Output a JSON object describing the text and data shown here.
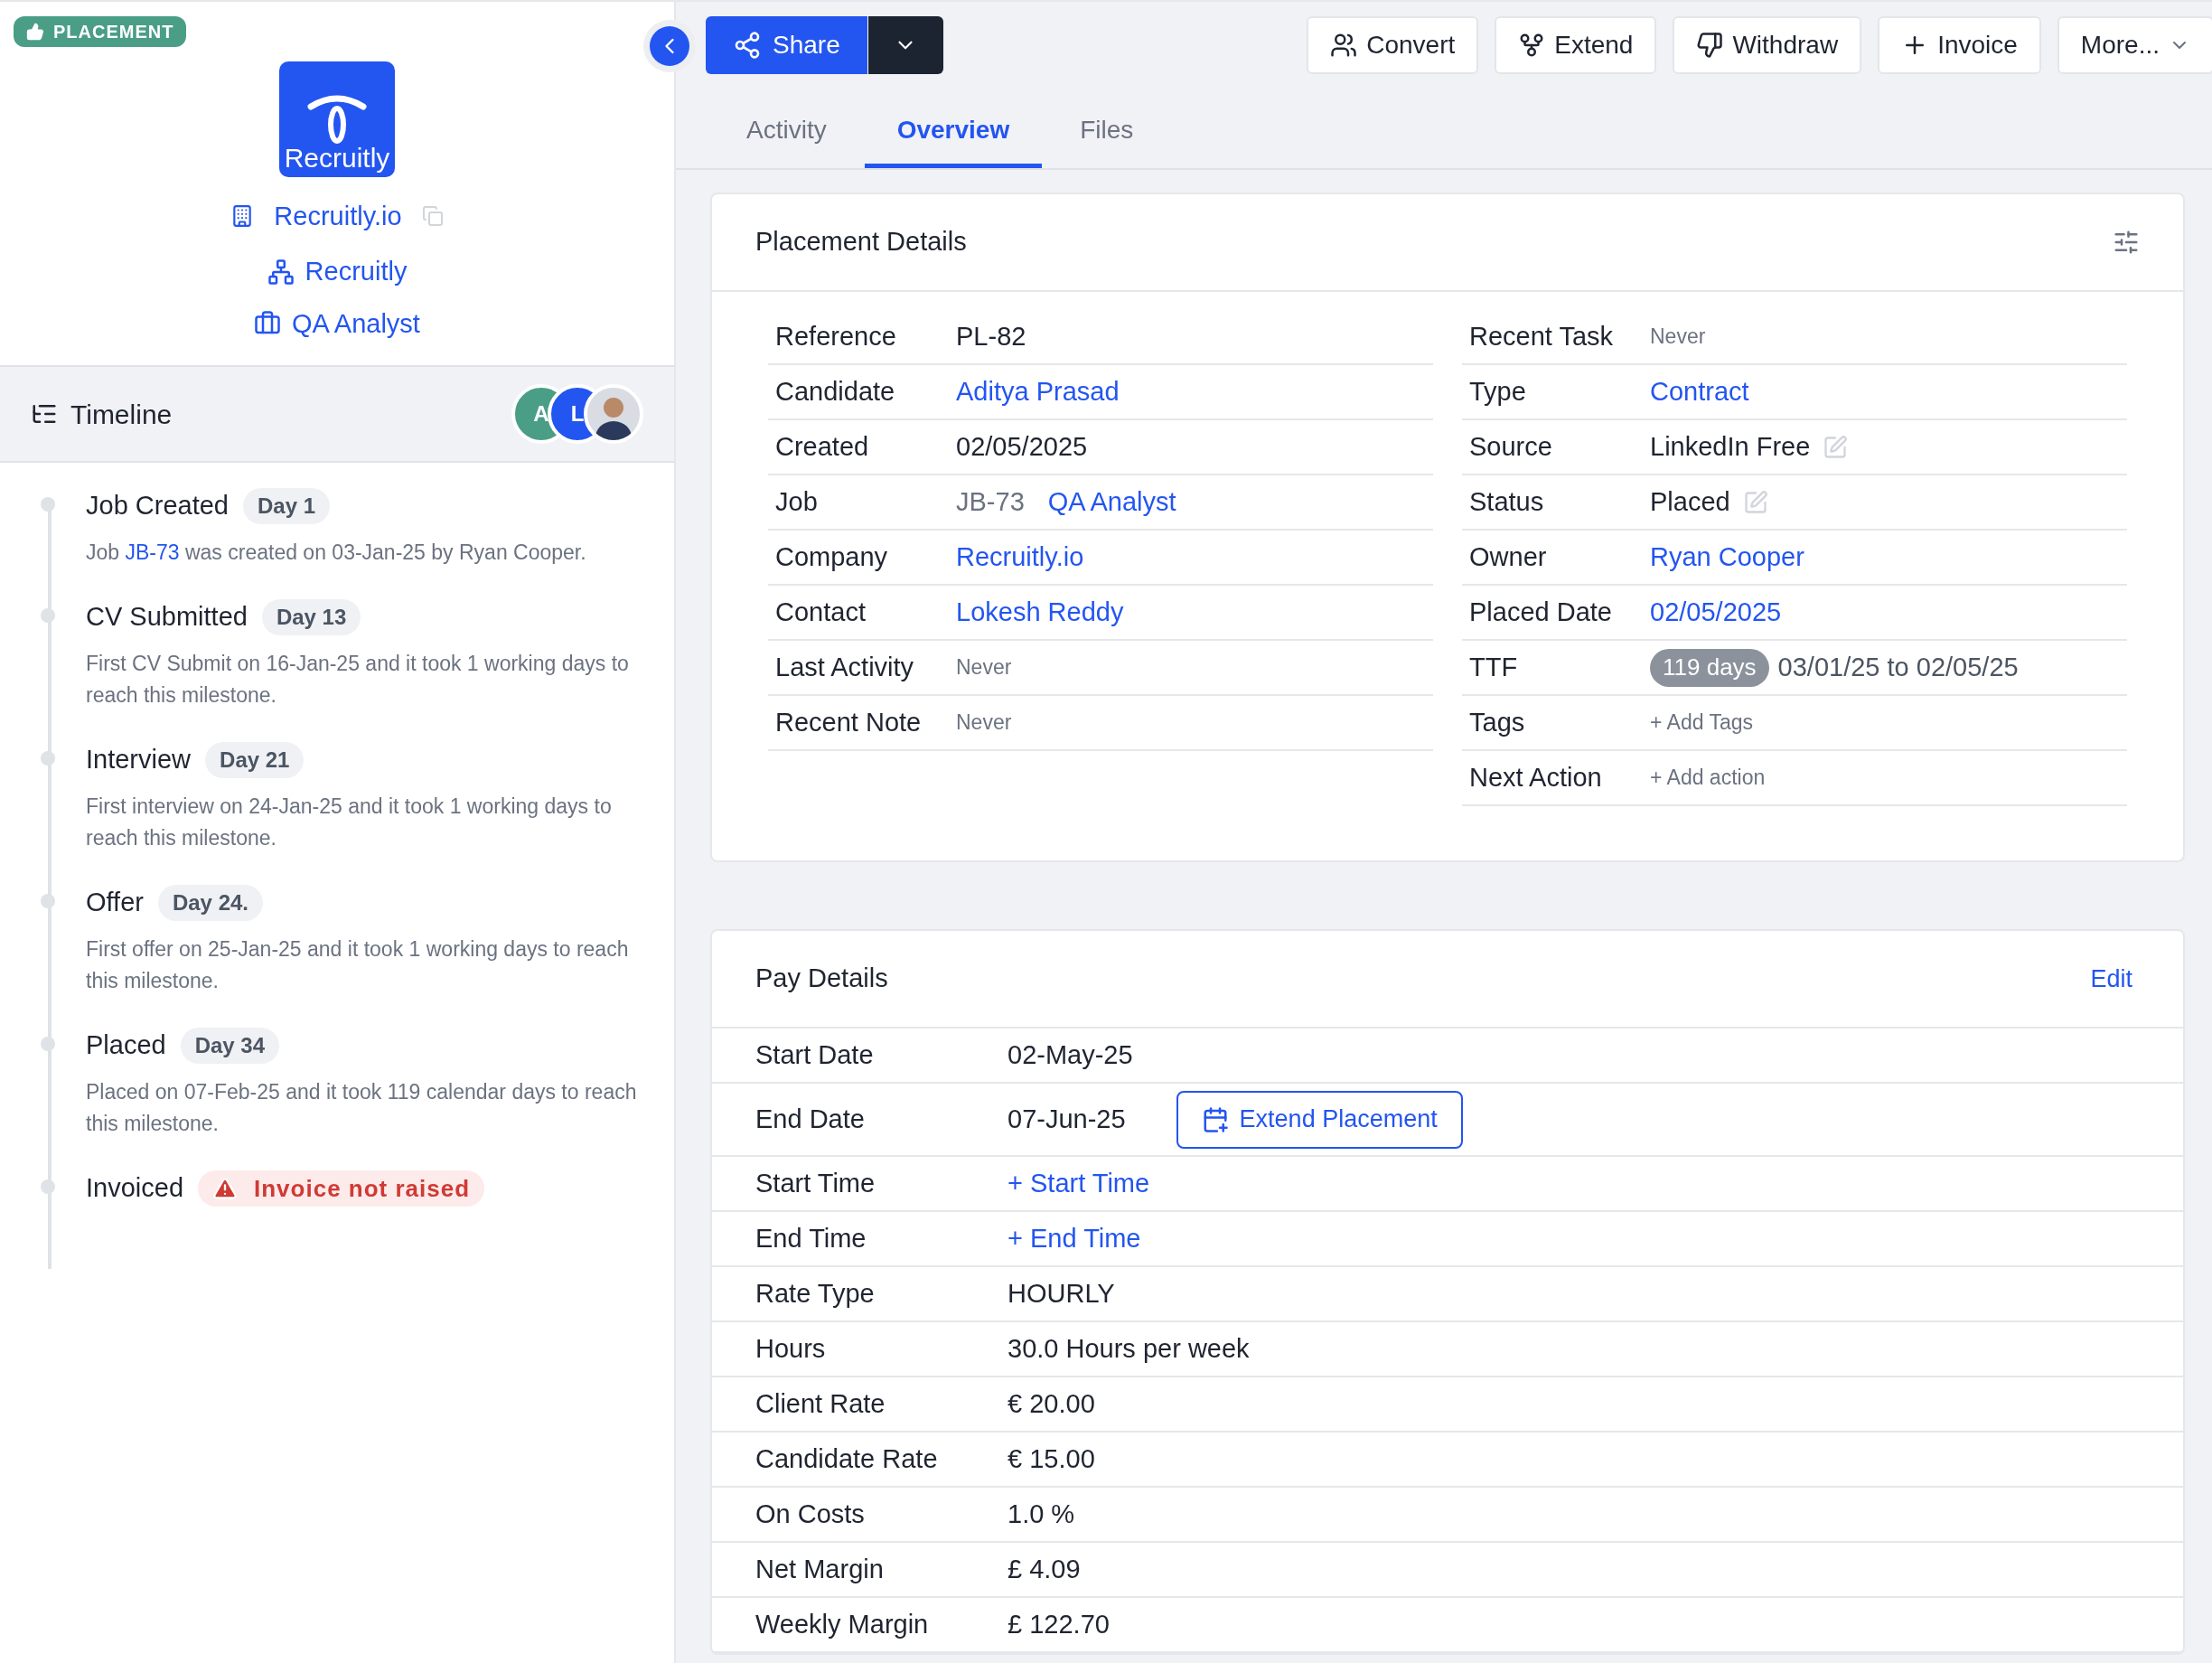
{
  "badge": {
    "label": "PLACEMENT"
  },
  "company": {
    "logo_text": "Recruitly",
    "name": "Recruitly.io",
    "group": "Recruitly",
    "job": "QA Analyst"
  },
  "timeline": {
    "title": "Timeline",
    "avatars": [
      {
        "kind": "initials",
        "initials": "A",
        "color": "#4a9e86"
      },
      {
        "kind": "initials",
        "initials": "L",
        "color": "#2355f0"
      },
      {
        "kind": "photo"
      }
    ],
    "events": [
      {
        "kind": "milestone",
        "title": "Job Created",
        "day": "Day 1",
        "parts": [
          {
            "kind": "text",
            "text": "Job "
          },
          {
            "kind": "link",
            "text": "JB-73"
          },
          {
            "kind": "text",
            "text": " was created on 03-Jan-25 by Ryan Cooper."
          }
        ]
      },
      {
        "kind": "milestone",
        "title": "CV Submitted",
        "day": "Day 13",
        "parts": [
          {
            "kind": "text",
            "text": "First CV Submit on 16-Jan-25 and it took 1 working days to reach this milestone."
          }
        ]
      },
      {
        "kind": "milestone",
        "title": "Interview",
        "day": "Day 21",
        "parts": [
          {
            "kind": "text",
            "text": "First interview on 24-Jan-25 and it took 1 working days to reach this milestone."
          }
        ]
      },
      {
        "kind": "milestone",
        "title": "Offer",
        "day": "Day 24.",
        "parts": [
          {
            "kind": "text",
            "text": "First offer on 25-Jan-25 and it took 1 working days to reach this milestone."
          }
        ]
      },
      {
        "kind": "milestone",
        "title": "Placed",
        "day": "Day 34",
        "parts": [
          {
            "kind": "text",
            "text": "Placed on 07-Feb-25 and it took 119 calendar days to reach this milestone."
          }
        ]
      },
      {
        "kind": "alert",
        "title": "Invoiced",
        "alert": "Invoice not raised"
      }
    ]
  },
  "toolbar": {
    "share": "Share",
    "buttons": [
      {
        "kind": "convert",
        "label": "Convert"
      },
      {
        "kind": "extend",
        "label": "Extend"
      },
      {
        "kind": "withdraw",
        "label": "Withdraw"
      },
      {
        "kind": "invoice",
        "label": "Invoice"
      },
      {
        "kind": "more",
        "label": "More..."
      }
    ]
  },
  "tabs": [
    {
      "label": "Activity",
      "selected": false
    },
    {
      "label": "Overview",
      "selected": true
    },
    {
      "label": "Files",
      "selected": false
    }
  ],
  "placement_details": {
    "title": "Placement Details",
    "left": [
      {
        "kind": "text",
        "label": "Reference",
        "value": "PL-82"
      },
      {
        "kind": "link",
        "label": "Candidate",
        "value": "Aditya Prasad"
      },
      {
        "kind": "text",
        "label": "Created",
        "value": "02/05/2025"
      },
      {
        "kind": "job",
        "label": "Job",
        "code": "JB-73",
        "value": "QA Analyst"
      },
      {
        "kind": "link",
        "label": "Company",
        "value": "Recruitly.io"
      },
      {
        "kind": "link",
        "label": "Contact",
        "value": "Lokesh Reddy"
      },
      {
        "kind": "muted",
        "label": "Last Activity",
        "value": "Never"
      },
      {
        "kind": "muted",
        "label": "Recent Note",
        "value": "Never"
      }
    ],
    "right": [
      {
        "kind": "muted",
        "label": "Recent Task",
        "value": "Never"
      },
      {
        "kind": "link",
        "label": "Type",
        "value": "Contract"
      },
      {
        "kind": "editable",
        "label": "Source",
        "value": "LinkedIn Free"
      },
      {
        "kind": "editable",
        "label": "Status",
        "value": "Placed"
      },
      {
        "kind": "link",
        "label": "Owner",
        "value": "Ryan Cooper"
      },
      {
        "kind": "link",
        "label": "Placed Date",
        "value": "02/05/2025"
      },
      {
        "kind": "ttf",
        "label": "TTF",
        "badge": "119 days",
        "value": "03/01/25 to 02/05/25"
      },
      {
        "kind": "muted",
        "label": "Tags",
        "value": "+ Add Tags"
      },
      {
        "kind": "muted",
        "label": "Next Action",
        "value": "+ Add action"
      }
    ]
  },
  "pay_details": {
    "title": "Pay Details",
    "edit": "Edit",
    "rows": [
      {
        "kind": "text",
        "label": "Start Date",
        "value": "02-May-25"
      },
      {
        "kind": "extend",
        "label": "End Date",
        "value": "07-Jun-25",
        "action": "Extend Placement"
      },
      {
        "kind": "link",
        "label": "Start Time",
        "value": "+ Start Time"
      },
      {
        "kind": "link",
        "label": "End Time",
        "value": "+ End Time"
      },
      {
        "kind": "text",
        "label": "Rate Type",
        "value": "HOURLY"
      },
      {
        "kind": "text",
        "label": "Hours",
        "value": "30.0 Hours per week"
      },
      {
        "kind": "text",
        "label": "Client Rate",
        "value": "€ 20.00"
      },
      {
        "kind": "text",
        "label": "Candidate Rate",
        "value": "€ 15.00"
      },
      {
        "kind": "text",
        "label": "On Costs",
        "value": "1.0 %"
      },
      {
        "kind": "text",
        "label": "Net Margin",
        "value": "£ 4.09"
      },
      {
        "kind": "text",
        "label": "Weekly Margin",
        "value": "£ 122.70"
      }
    ]
  }
}
